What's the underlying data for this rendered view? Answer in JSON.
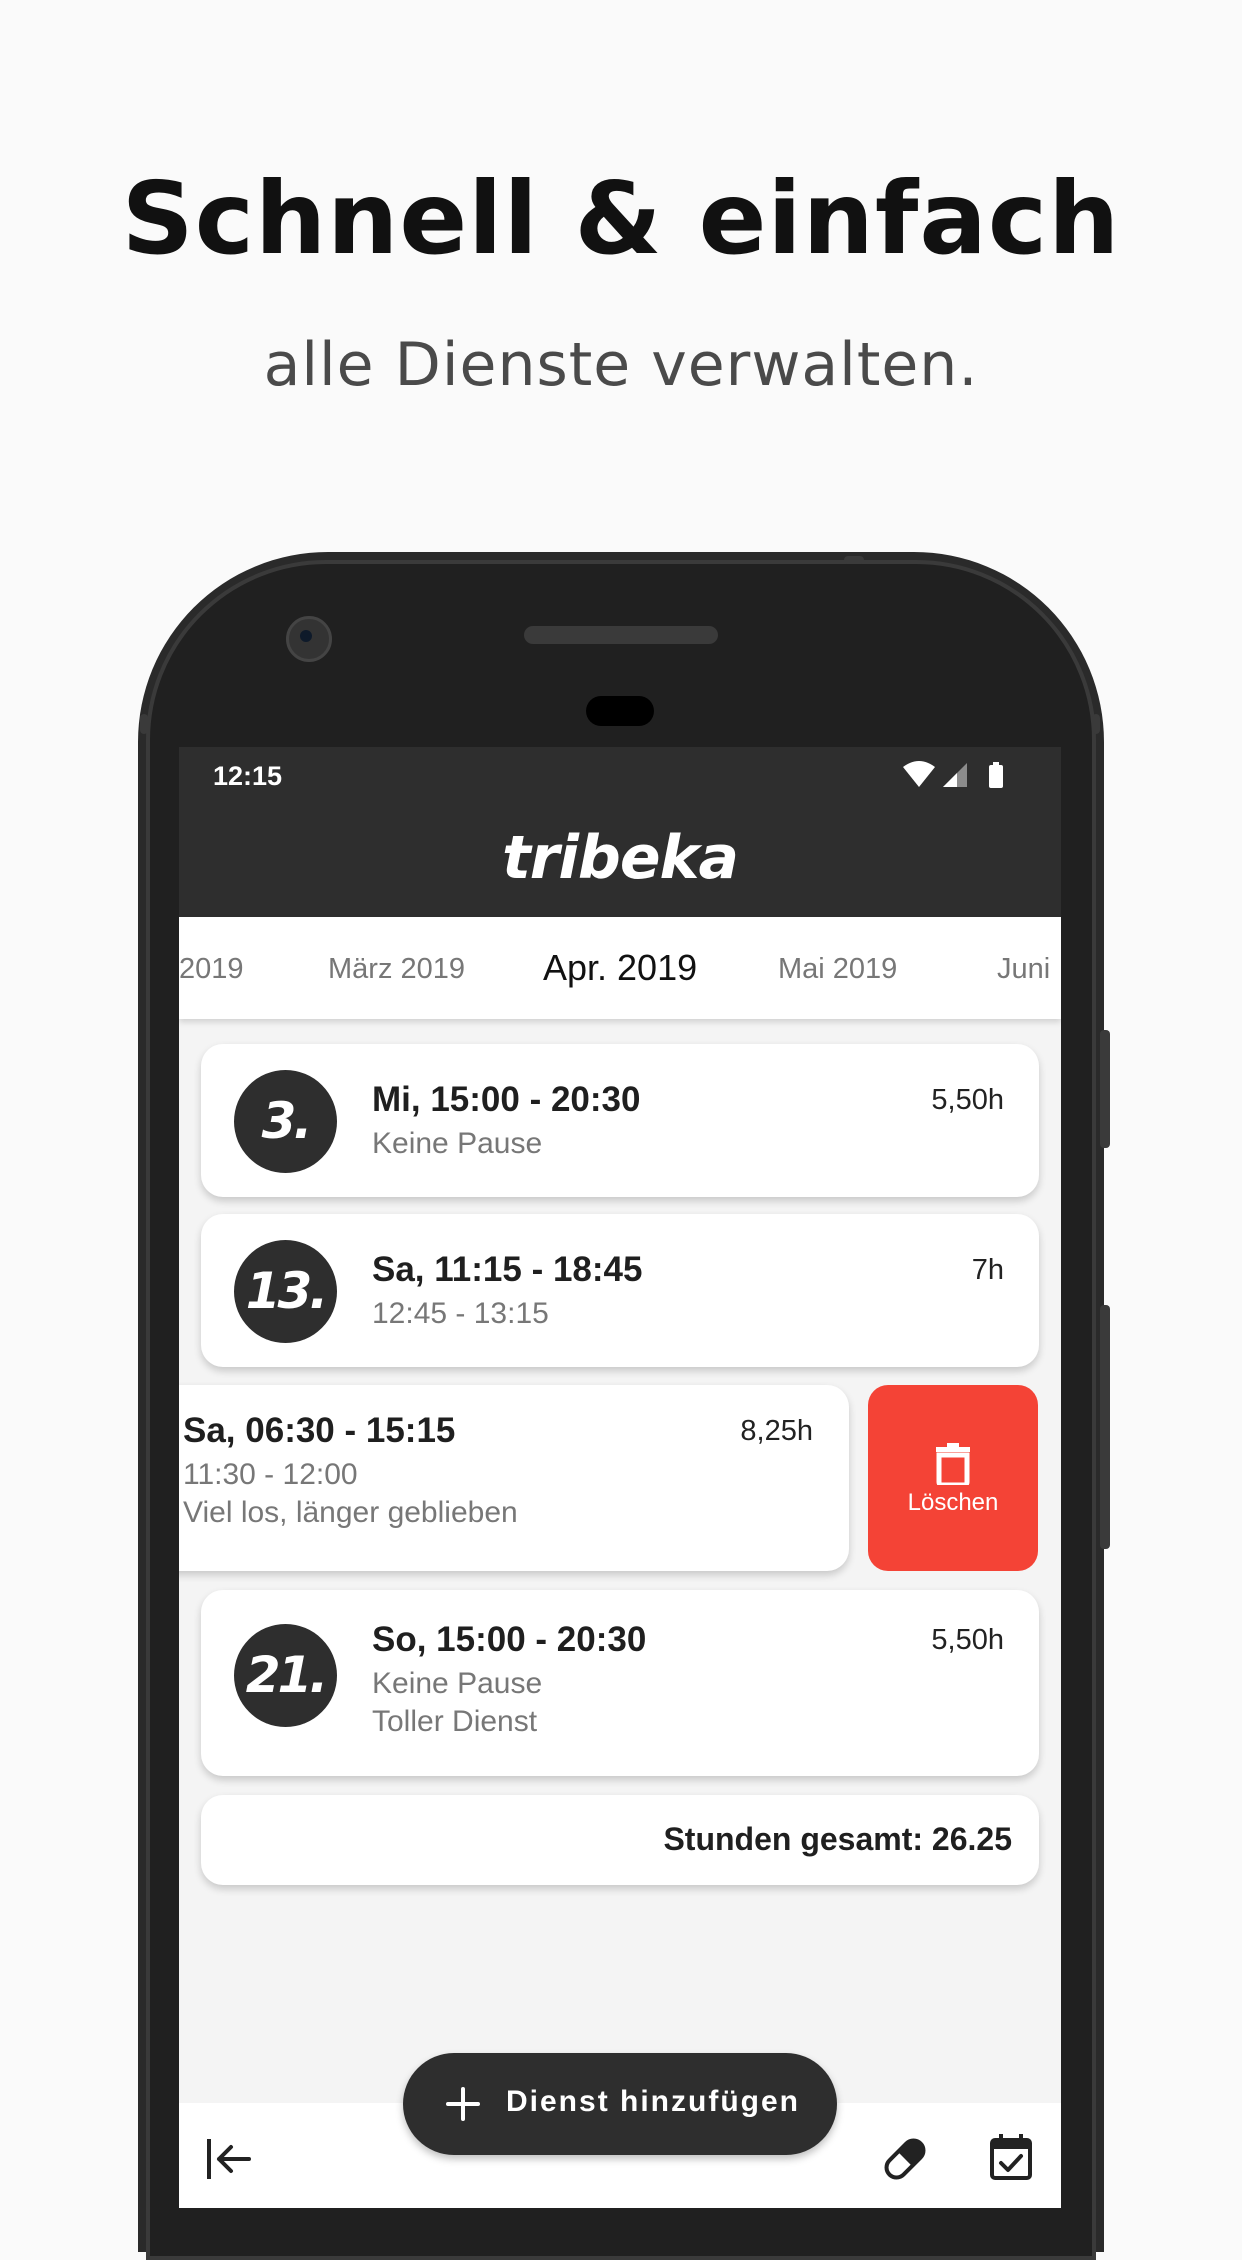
{
  "promo": {
    "headline": "Schnell & einfach",
    "subline": "alle Dienste verwalten."
  },
  "status_bar": {
    "time": "12:15",
    "icons": [
      "wifi-icon",
      "signal-icon",
      "battery-icon"
    ]
  },
  "app_bar": {
    "title": "tribeka"
  },
  "months": {
    "items": [
      {
        "label": "2019",
        "active": false
      },
      {
        "label": "März 2019",
        "active": false
      },
      {
        "label": "Apr. 2019",
        "active": true
      },
      {
        "label": "Mai 2019",
        "active": false
      },
      {
        "label": "Juni",
        "active": false
      }
    ]
  },
  "shifts": [
    {
      "day": "3.",
      "title": "Mi, 15:00 - 20:30",
      "break": "Keine Pause",
      "note": "",
      "hours": "5,50h"
    },
    {
      "day": "13.",
      "title": "Sa, 11:15 - 18:45",
      "break": "12:45 - 13:15",
      "note": "",
      "hours": "7h"
    },
    {
      "day": "",
      "title": "Sa, 06:30 - 15:15",
      "break": "11:30 - 12:00",
      "note": "Viel los, länger geblieben",
      "hours": "8,25h"
    },
    {
      "day": "21.",
      "title": "So, 15:00 - 20:30",
      "break": "Keine Pause",
      "note": "Toller Dienst",
      "hours": "5,50h"
    }
  ],
  "delete_action": {
    "label": "Löschen",
    "color": "#f44336"
  },
  "total": {
    "label": "Stunden gesamt: 26.25"
  },
  "fab": {
    "label": "Dienst hinzufügen"
  },
  "bottom_nav": {
    "icons": [
      "logout-icon",
      "pill-icon",
      "calendar-check-icon"
    ]
  },
  "colors": {
    "primary_dark": "#2e2e2e",
    "accent_red": "#f44336",
    "background": "#f4f4f4"
  }
}
